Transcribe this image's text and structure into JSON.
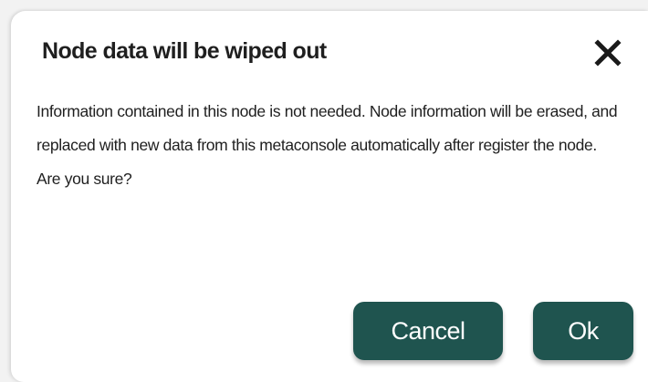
{
  "dialog": {
    "title": "Node data will be wiped out",
    "close_icon": "close-icon",
    "message": "Information contained in this node is not needed. Node information will be erased, and replaced with new data from this metaconsole automatically after register the node. Are you sure?",
    "cancel_label": "Cancel",
    "ok_label": "Ok"
  },
  "colors": {
    "button_bg": "#1f544f",
    "button_text": "#ffffff",
    "title_text": "#1f1f1f"
  }
}
